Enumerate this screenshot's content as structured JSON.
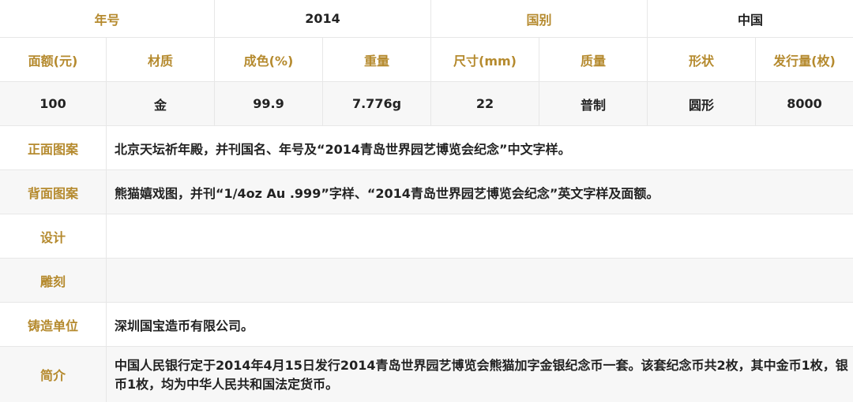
{
  "colors": {
    "label": "#b58a2e",
    "value": "#222222",
    "border": "#e7e7e7",
    "row_shade": "#f7f7f7"
  },
  "header": {
    "year_label": "年号",
    "year_value": "2014",
    "country_label": "国别",
    "country_value": "中国"
  },
  "specs": {
    "headers": [
      "面额(元)",
      "材质",
      "成色(%)",
      "重量",
      "尺寸(mm)",
      "质量",
      "形状",
      "发行量(枚)"
    ],
    "values": [
      "100",
      "金",
      "99.9",
      "7.776g",
      "22",
      "普制",
      "圆形",
      "8000"
    ]
  },
  "details": [
    {
      "label": "正面图案",
      "text": "北京天坛祈年殿，并刊国名、年号及“2014青岛世界园艺博览会纪念”中文字样。"
    },
    {
      "label": "背面图案",
      "text": "熊猫嬉戏图，并刊“1/4oz Au .999”字样、“2014青岛世界园艺博览会纪念”英文字样及面额。"
    },
    {
      "label": "设计",
      "text": ""
    },
    {
      "label": "雕刻",
      "text": ""
    },
    {
      "label": "铸造单位",
      "text": "深圳国宝造币有限公司。"
    },
    {
      "label": "简介",
      "text": "中国人民银行定于2014年4月15日发行2014青岛世界园艺博览会熊猫加字金银纪念币一套。该套纪念币共2枚，其中金币1枚，银币1枚，均为中华人民共和国法定货币。"
    }
  ]
}
